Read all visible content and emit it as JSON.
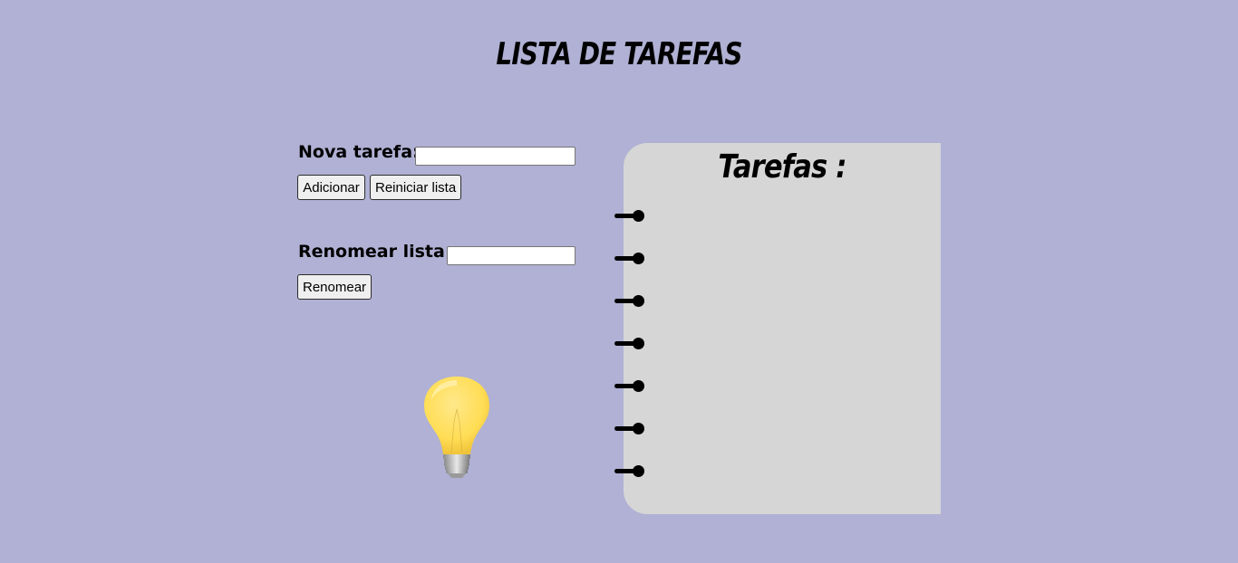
{
  "header": {
    "title": "LISTA DE TAREFAS"
  },
  "add_form": {
    "label": "Nova tarefa:",
    "input_value": "",
    "add_button": "Adicionar",
    "reset_button": "Reiniciar lista"
  },
  "rename_form": {
    "label": "Renomear lista:",
    "input_value": "",
    "rename_button": "Renomear"
  },
  "illustration": {
    "icon": "lightbulb-icon"
  },
  "notebook": {
    "title": "Tarefas :",
    "tasks": []
  },
  "colors": {
    "background": "#b0b1d4",
    "notebook": "#d6d6d6",
    "rings": "#000000",
    "bulb": "#ffdd55"
  }
}
